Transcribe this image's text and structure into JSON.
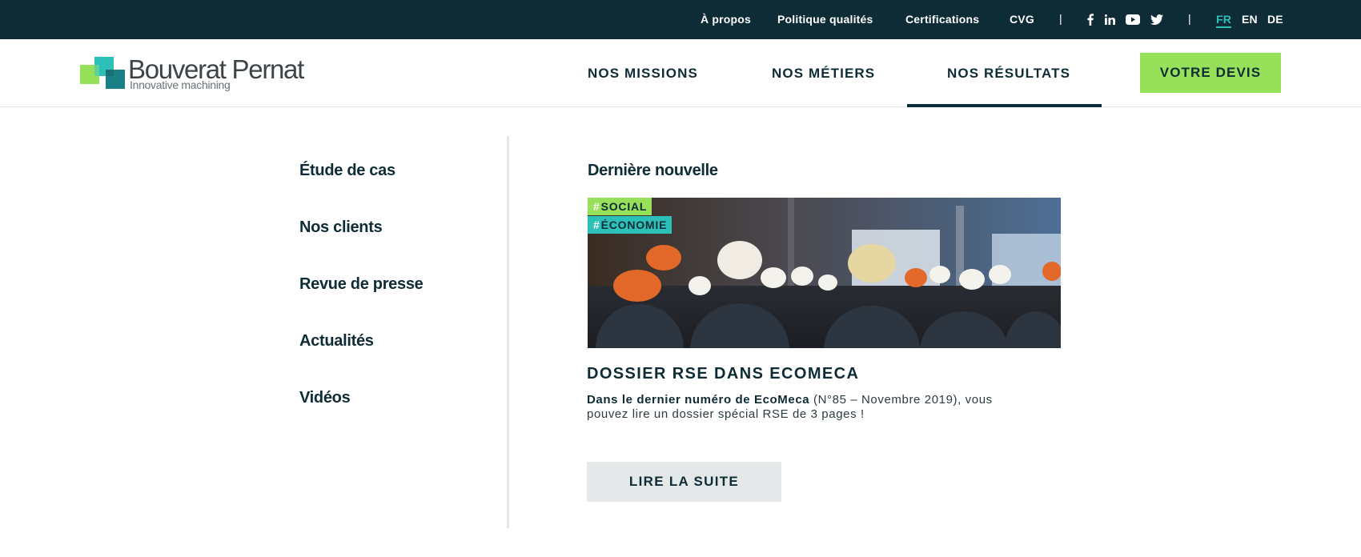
{
  "topbar": {
    "links": [
      "À propos",
      "Politique qualités",
      "Certifications",
      "CVG"
    ],
    "separator": "|",
    "social_icons": [
      "facebook-icon",
      "linkedin-icon",
      "youtube-icon",
      "twitter-icon"
    ],
    "languages": [
      "FR",
      "EN",
      "DE"
    ],
    "active_language": "FR"
  },
  "brand": {
    "name": "Bouverat Pernat",
    "tagline": "Innovative machining"
  },
  "nav": {
    "items": [
      "NOS MISSIONS",
      "NOS MÉTIERS",
      "NOS RÉSULTATS"
    ],
    "active": "NOS RÉSULTATS",
    "cta": "VOTRE DEVIS"
  },
  "submenu": {
    "items": [
      "Étude de cas",
      "Nos clients",
      "Revue de presse",
      "Actualités",
      "Vidéos"
    ]
  },
  "news": {
    "heading": "Dernière nouvelle",
    "tags": [
      {
        "hash": "#",
        "label": "SOCIAL",
        "color": "#97e05a"
      },
      {
        "hash": "#",
        "label": "ÉCONOMIE",
        "color": "#2cc0b9"
      }
    ],
    "title": "DOSSIER RSE DANS ECOMECA",
    "text_bold": "Dans le dernier numéro de EcoMeca",
    "text_rest": " (N°85 – Novembre 2019), vous pouvez lire un dossier spécial RSE de 3 pages !",
    "button": "LIRE LA SUITE"
  },
  "colors": {
    "dark": "#0e2c35",
    "green": "#97e05a",
    "teal": "#2cc0b9",
    "light_gray": "#e4e8e9"
  }
}
